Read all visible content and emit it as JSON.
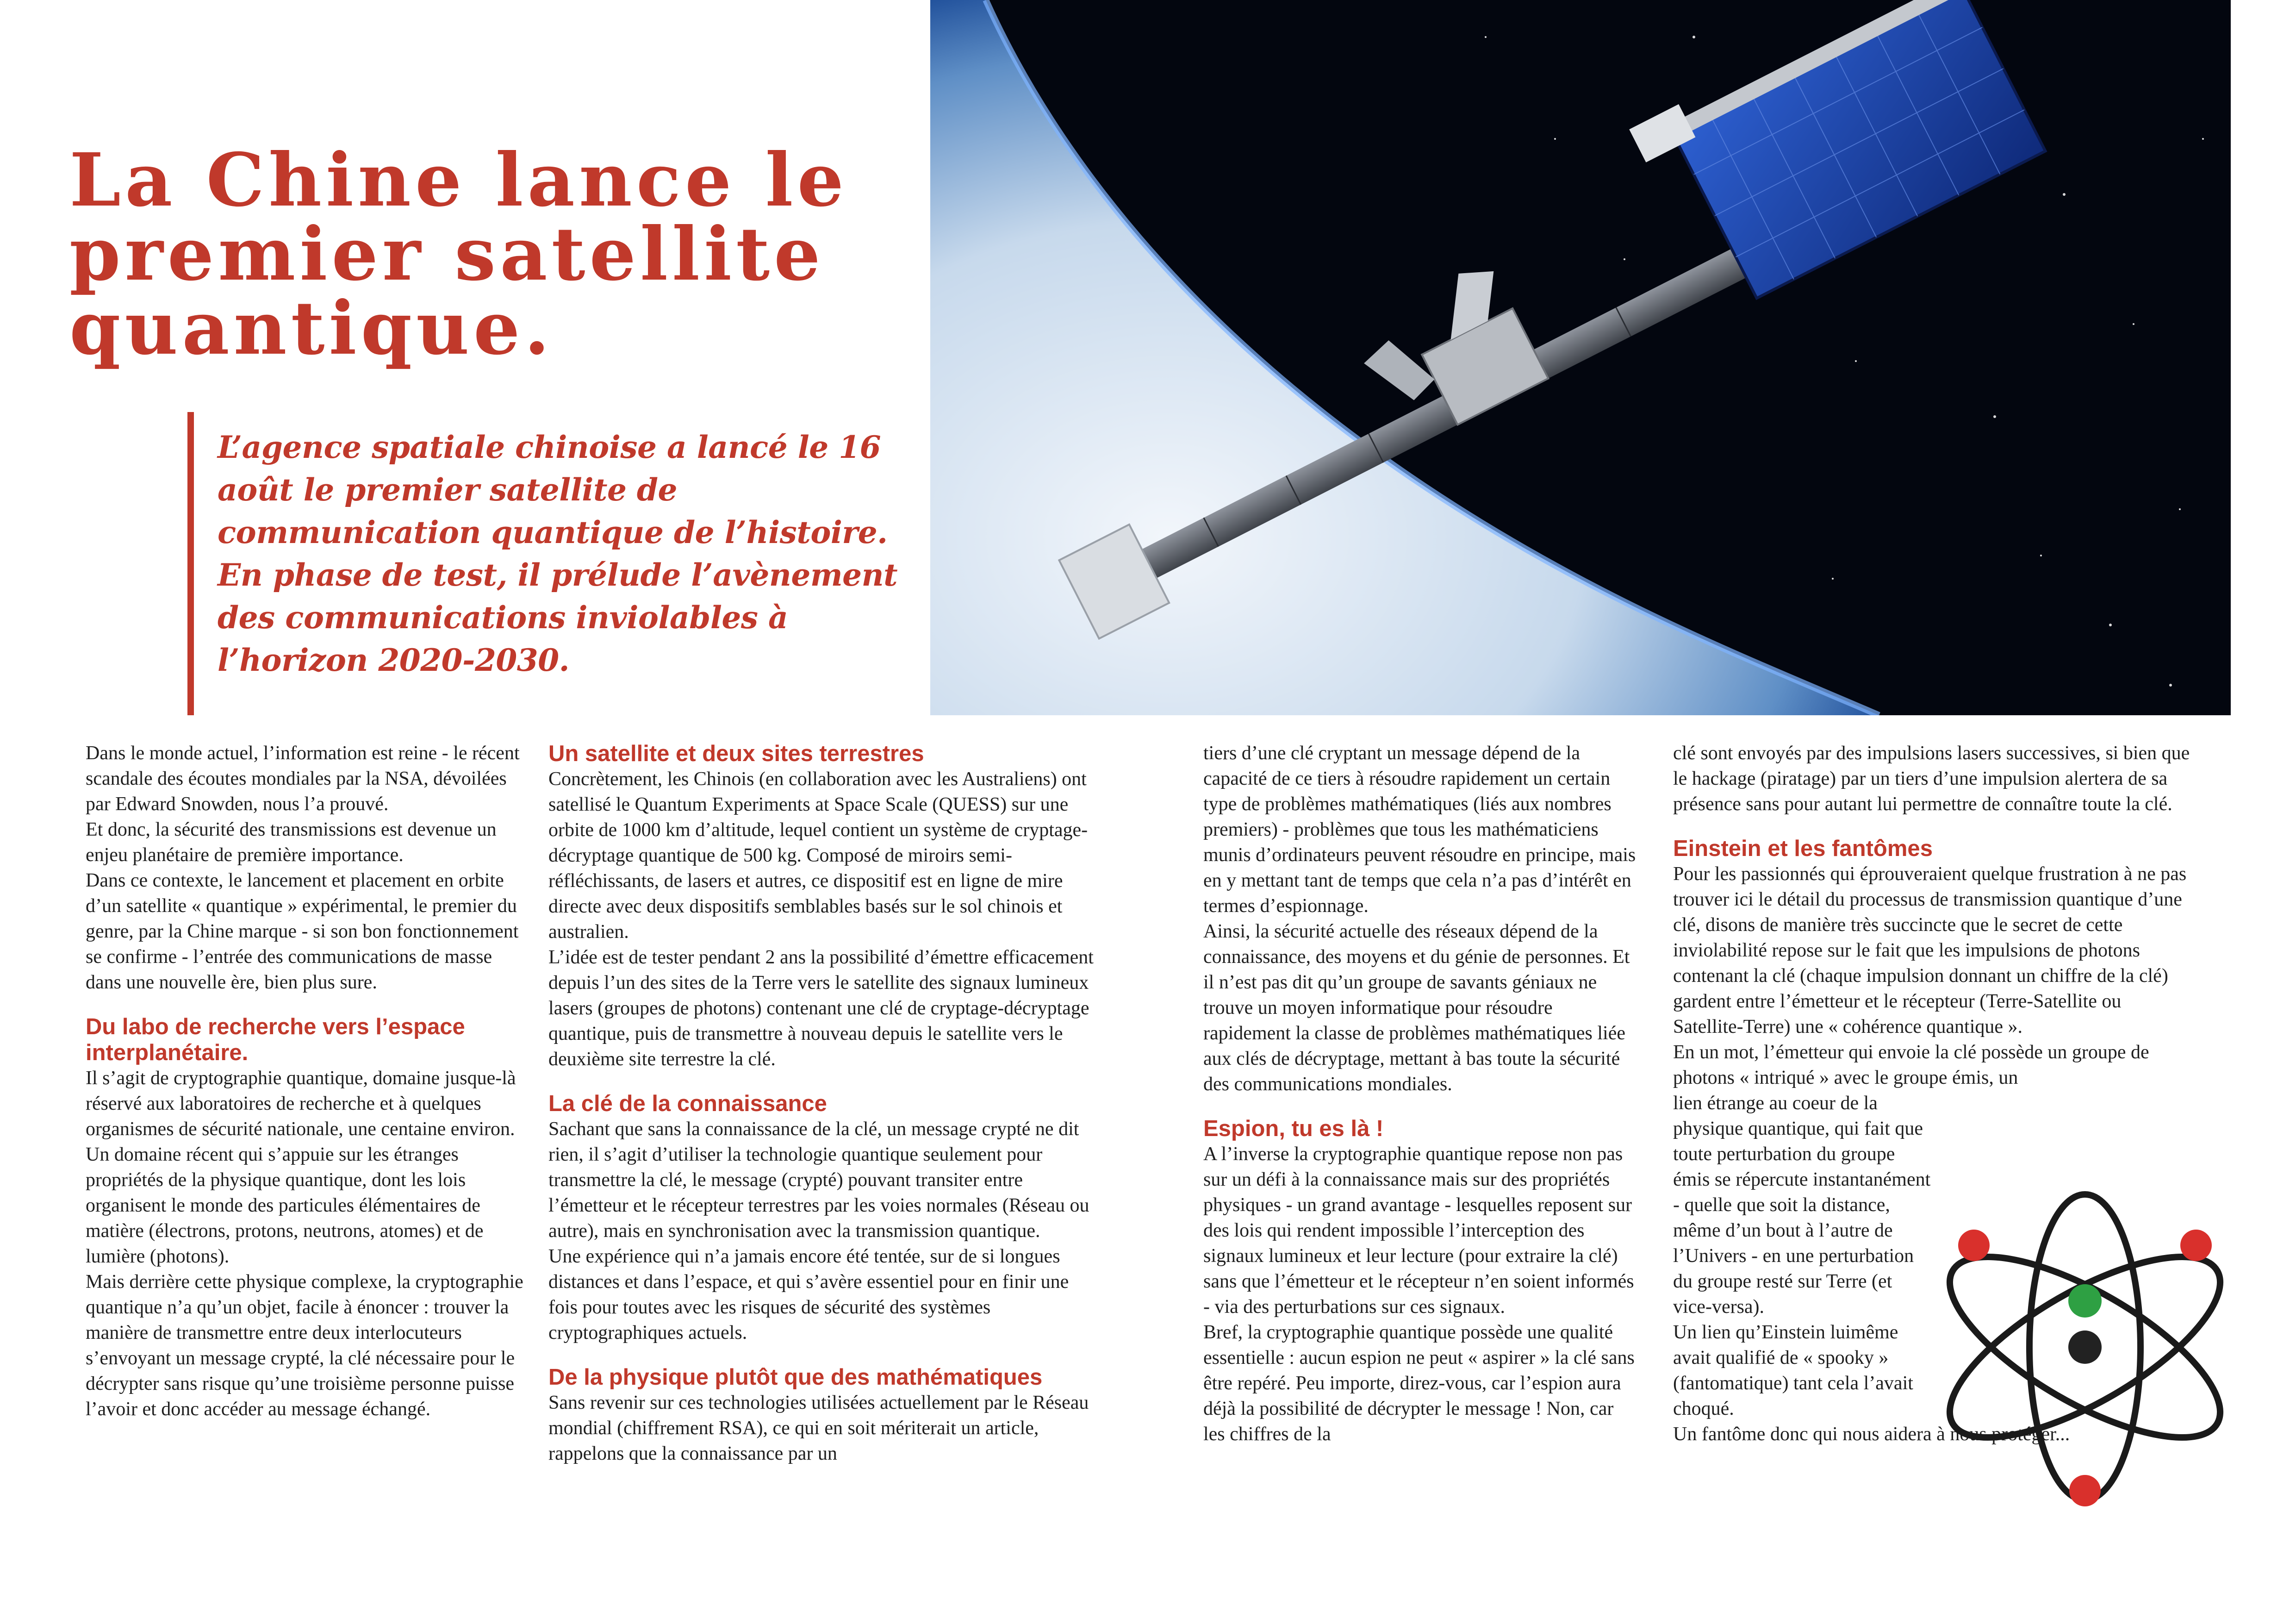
{
  "article": {
    "title": "La Chine lance le premier satellite quantique.",
    "lead": "L’agence spatiale chinoise a lancé le 16 août le premier satellite de communication quantique de l’histoire. En phase de test, il prélude l’avènement des communications inviolables à l’horizon 2020-2030."
  },
  "col1": {
    "p1": "Dans le monde actuel, l’information est reine - le récent scandale des écoutes mondiales par la NSA, dévoilées par Edward Snowden, nous l’a prouvé.",
    "p2": "Et donc, la sécurité des transmissions est devenue un enjeu planétaire de première importance.",
    "p3": "Dans ce contexte, le lancement et placement en orbite d’un satellite « quantique » expérimental, le premier du genre, par la Chine marque - si son bon fonctionnement se confirme - l’entrée des communications de masse dans une nouvelle ère, bien plus sure.",
    "h1": "Du labo de recherche vers l’espace interplanétaire.",
    "p4": "Il s’agit de cryptographie quantique, domaine jusque-là réservé aux laboratoires de recherche et à quelques organismes de sécurité nationale, une centaine environ. Un domaine récent qui s’appuie sur les étranges propriétés de la physique quantique, dont les lois organisent le monde des particules élémentaires de matière (électrons, protons, neutrons, atomes) et de lumière (photons).",
    "p5": "Mais derrière cette physique complexe, la cryptographie quantique n’a qu’un objet, facile à énoncer : trouver la manière de transmettre entre deux interlocuteurs s’envoyant un message crypté, la clé nécessaire pour le décrypter sans risque qu’une troisième personne puisse l’avoir et donc accéder au message échangé."
  },
  "col2": {
    "h1": "Un satellite et deux sites terrestres",
    "p1": "Concrètement, les Chinois (en collaboration avec les Australiens) ont satellisé le Quantum Experiments at Space Scale (QUESS) sur une orbite de 1000 km d’altitude, lequel contient un système de cryptage-décryptage quantique de 500 kg. Composé de miroirs semi-réfléchissants, de lasers et autres, ce dispositif est en ligne de mire directe avec deux dispositifs semblables basés sur le sol chinois et australien.",
    "p2": "L’idée est de tester pendant 2 ans la possibilité d’émettre efficacement depuis l’un des sites de la Terre vers le satellite des signaux lumineux lasers (groupes de photons) contenant une clé de cryptage-décryptage quantique, puis de transmettre à nouveau depuis le satellite vers le deuxième site terrestre la clé.",
    "h2": "La clé de la connaissance",
    "p3": "Sachant que sans la connaissance de la clé, un message crypté ne dit rien, il s’agit d’utiliser la technologie quantique seulement pour transmettre la clé, le message (crypté) pouvant transiter entre l’émetteur et le récepteur terrestres par les voies normales (Réseau ou autre), mais en synchronisation avec la transmission quantique.",
    "p4": "Une expérience qui n’a jamais encore été tentée, sur de si longues distances et dans l’espace, et qui s’avère essentiel pour en finir une fois pour toutes avec les risques de sécurité des systèmes cryptographiques actuels.",
    "h3": "De la physique plutôt que des mathématiques",
    "p5": "Sans revenir sur ces technologies utilisées actuellement par le Réseau mondial (chiffrement RSA), ce qui en soit mériterait un article, rappelons que la connaissance par un"
  },
  "col3": {
    "p1": "tiers d’une clé cryptant un message dépend de la capacité de ce tiers à résoudre rapidement un certain type de problèmes mathématiques (liés aux nombres premiers) - problèmes que tous les mathématiciens munis d’ordinateurs peuvent résoudre en principe, mais en y mettant tant de temps que cela n’a pas d’intérêt en termes d’espionnage.",
    "p2": "Ainsi, la sécurité actuelle des réseaux dépend de la connaissance, des moyens et du génie de personnes. Et il n’est pas dit qu’un groupe de savants géniaux ne trouve un moyen informatique pour résoudre rapidement la classe de problèmes mathématiques liée aux clés de décryptage, mettant à bas toute la sécurité des communications mondiales.",
    "h1": "Espion, tu es là !",
    "p3": "A l’inverse la cryptographie quantique repose non pas sur un défi à la connaissance mais sur des propriétés physiques - un grand avantage - lesquelles reposent sur des lois qui rendent impossible l’interception des signaux lumineux et leur lecture (pour extraire la clé) sans que l’émetteur et le récepteur n’en soient informés - via des perturbations sur ces signaux.",
    "p4": "Bref, la cryptographie quantique possède une qualité essentielle : aucun espion ne peut « aspirer » la clé sans être repéré. Peu importe, direz-vous, car l’espion aura déjà la possibilité de décrypter le message ! Non, car les chiffres de la"
  },
  "col4": {
    "p1": "clé sont envoyés par des impulsions lasers successives, si bien que le hackage (piratage) par un tiers d’une impulsion alertera de sa présence sans pour autant lui permettre de connaître toute la clé.",
    "h1": "Einstein et les fantômes",
    "p2": "Pour les passionnés qui éprouveraient quelque frustration à ne pas trouver ici le détail du processus de transmission quantique d’une clé, disons de manière très succincte que le secret de cette inviolabilité repose sur le fait que les impulsions de photons contenant la clé (chaque impulsion donnant un chiffre de la clé) gardent entre l’émetteur et le récepteur (Terre-Satellite ou Satellite-Terre) une « cohérence quantique ».",
    "p3a": "En un mot, l’émetteur qui envoie la clé possède un groupe de photons « intriqué » avec le groupe émis, un",
    "p3b": "lien étrange au coeur de la physique quantique, qui fait que toute perturbation du groupe émis se répercute instantanément - quelle que soit la distance, même d’un bout à l’autre de l’Univers - en une perturbation du groupe resté sur Terre (et vice-versa).",
    "p4": "Un lien qu’Einstein luimême avait qualifié de « spooky » (fantomatique) tant cela l’avait choqué.",
    "p5": "Un fantôme donc qui nous aidera à nous protéger..."
  },
  "colors": {
    "accent": "#c0392b",
    "electron_red": "#d9302c",
    "nucleus_green": "#2ea043",
    "nucleus_black": "#222222"
  }
}
